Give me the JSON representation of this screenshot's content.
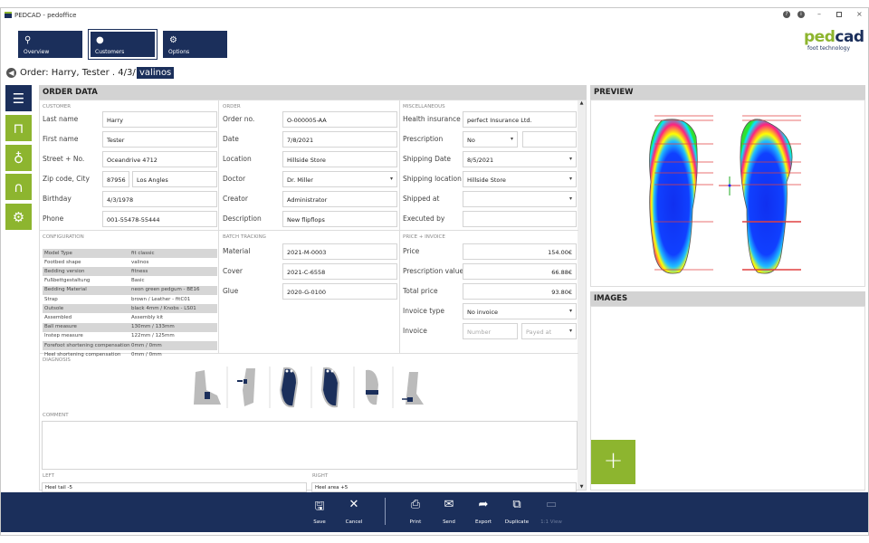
{
  "window": {
    "title": "PEDCAD - pedoffice",
    "controls": [
      "help",
      "info",
      "minimize",
      "restore",
      "close"
    ]
  },
  "logo": {
    "name": "pedcad",
    "tagline": "foot technology",
    "color_ped": "#8db52f",
    "color_cad": "#1b2f5b"
  },
  "nav": [
    {
      "label": "Overview",
      "icon": "chart-icon"
    },
    {
      "label": "Customers",
      "icon": "user-icon",
      "selected": true
    },
    {
      "label": "Options",
      "icon": "gear-icon"
    }
  ],
  "breadcrumb": {
    "title": "Order: Harry, Tester . 4/3/1978 .",
    "tag": "valinos"
  },
  "sidebar": [
    {
      "icon": "order-list-icon",
      "selected": true
    },
    {
      "icon": "feet-icon"
    },
    {
      "icon": "stethoscope-icon"
    },
    {
      "icon": "insoles-icon"
    },
    {
      "icon": "settings-icon"
    }
  ],
  "order_data": {
    "title": "ORDER DATA",
    "customer": {
      "section": "CUSTOMER",
      "last_name_label": "Last name",
      "last_name": "Harry",
      "first_name_label": "First name",
      "first_name": "Tester",
      "street_label": "Street + No.",
      "street": "Oceandrive 4712",
      "zip_label": "Zip code, City",
      "zip": "87956",
      "city": "Los Angles",
      "birthday_label": "Birthday",
      "birthday": "4/3/1978",
      "phone_label": "Phone",
      "phone": "001-55478-55444"
    },
    "order": {
      "section": "ORDER",
      "order_no_label": "Order no.",
      "order_no": "O-000005-AA",
      "date_label": "Date",
      "date": "7/8/2021",
      "location_label": "Location",
      "location": "Hillside Store",
      "doctor_label": "Doctor",
      "doctor": "Dr. Miller",
      "creator_label": "Creator",
      "creator": "Administrator",
      "description_label": "Description",
      "description": "New flipflops"
    },
    "misc": {
      "section": "MISCELLANEOUS",
      "health_label": "Health insurance",
      "health": "perfect Insurance Ltd.",
      "prescription_label": "Prescription",
      "prescription": "No",
      "prescription_extra": "",
      "shipping_date_label": "Shipping Date",
      "shipping_date": "8/5/2021",
      "shipping_location_label": "Shipping location",
      "shipping_location": "Hillside Store",
      "shipped_at_label": "Shipped at",
      "shipped_at": "",
      "executed_by_label": "Executed by",
      "executed_by": ""
    },
    "configuration": {
      "section": "CONFIGURATION",
      "rows": [
        [
          "Model Type",
          "fit classic"
        ],
        [
          "Footbed shape",
          "valinos"
        ],
        [
          "Bedding version",
          "fitness"
        ],
        [
          "Fußbettgestaltung",
          "Basic"
        ],
        [
          "Bedding Material",
          "neon green pedgum - BE16"
        ],
        [
          "Strap",
          "brown / Leather - fitC01"
        ],
        [
          "Outsole",
          "black 4mm / Knobs - LS01"
        ],
        [
          "Assembled",
          "Assembly kit"
        ],
        [
          "Ball measure",
          "130mm / 133mm"
        ],
        [
          "Instep measure",
          "122mm / 125mm"
        ],
        [
          "Forefoot shortening compensation",
          "0mm / 0mm"
        ],
        [
          "Heel shortening compensation",
          "0mm / 0mm"
        ]
      ]
    },
    "batch": {
      "section": "BATCH TRACKING",
      "material_label": "Material",
      "material": "2021-M-0003",
      "cover_label": "Cover",
      "cover": "2021-C-6558",
      "glue_label": "Glue",
      "glue": "2020-G-0100"
    },
    "price": {
      "section": "PRICE + INVOICE",
      "price_label": "Price",
      "price": "154.00€",
      "prescription_value_label": "Prescription value",
      "prescription_value": "66.88€",
      "total_label": "Total price",
      "total": "93.80€",
      "invoice_type_label": "Invoice type",
      "invoice_type": "No invoice",
      "invoice_label": "Invoice",
      "invoice_number_placeholder": "Number",
      "payed_at_placeholder": "Payed at"
    },
    "diagnosis": {
      "section": "DIAGNOSIS"
    },
    "comment": {
      "section": "COMMENT",
      "value": ""
    },
    "left": {
      "section": "LEFT",
      "value": "Heel tail -5"
    },
    "right": {
      "section": "RIGHT",
      "value": "Heel area +5"
    }
  },
  "preview": {
    "title": "PREVIEW"
  },
  "images": {
    "title": "IMAGES",
    "add_icon": "plus-icon"
  },
  "toolbar": [
    {
      "label": "Save",
      "icon": "save-icon"
    },
    {
      "label": "Cancel",
      "icon": "close-icon"
    },
    {
      "label": "Print",
      "icon": "print-icon"
    },
    {
      "label": "Send",
      "icon": "mail-icon"
    },
    {
      "label": "Export",
      "icon": "share-icon"
    },
    {
      "label": "Duplicate",
      "icon": "duplicate-icon"
    },
    {
      "label": "1:1 View",
      "icon": "monitor-icon",
      "disabled": true
    }
  ]
}
